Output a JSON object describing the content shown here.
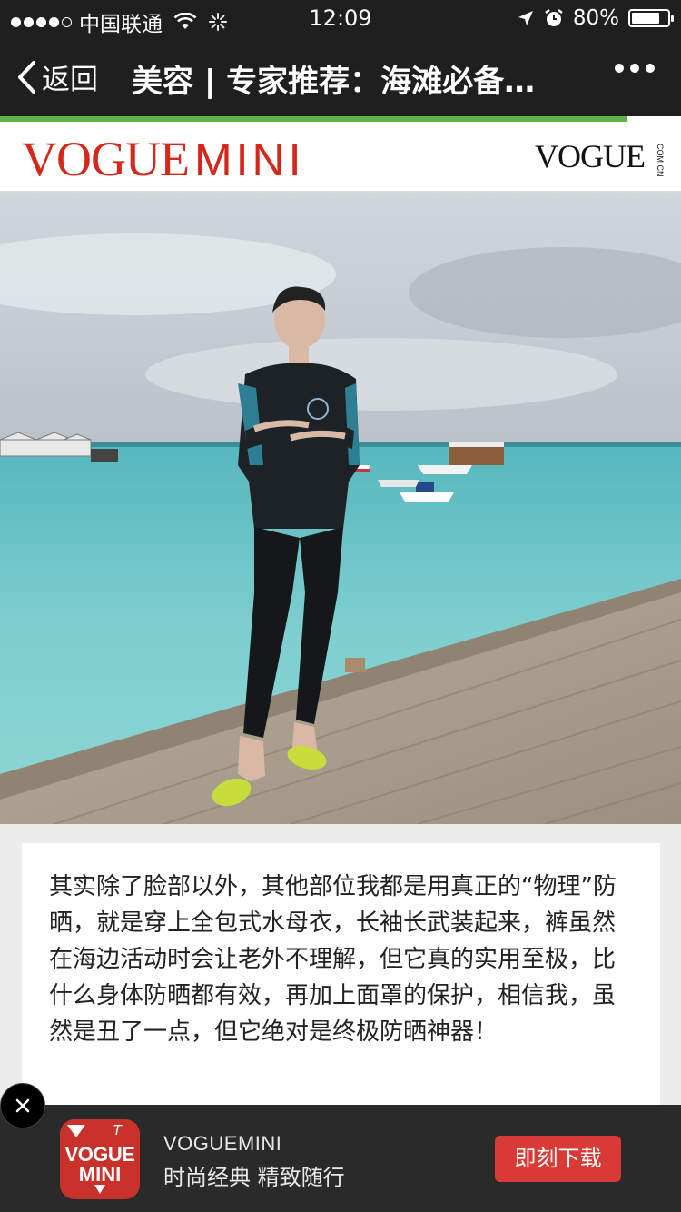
{
  "status_bar": {
    "carrier": "中国联通",
    "time": "12:09",
    "battery": "80%",
    "battery_level": 0.8
  },
  "nav": {
    "back_label": "返回",
    "title": "美容 | 专家推荐：海滩必备…"
  },
  "page_load_progress": 0.92,
  "brand": {
    "logo_main": "VOGUE",
    "logo_sub": "MINI",
    "logo_right": "VOGUE",
    "logo_right_sub": "COM.CN"
  },
  "article": {
    "paragraph": "其实除了脸部以外，其他部位我都是用真正的“物理”防晒，就是穿上全包式水母衣，长袖长武装起来，裤虽然在海边活动时会让老外不理解，但它真的实用至极，比什么身体防晒都有效，再加上面罩的保护，相信我，虽然是丑了一点，但它绝对是终极防晒神器！"
  },
  "ad_banner": {
    "app_icon_line1": "VOGUE",
    "app_icon_line2": "MINI",
    "app_icon_corner": "T",
    "app_name": "VOGUEMINI",
    "tagline": "时尚经典 精致随行",
    "button_label": "即刻下载"
  },
  "colors": {
    "bar_background": "#1f1f1f",
    "progress": "#5ab645",
    "brand_red": "#d5271b",
    "ad_button": "#d93a35"
  }
}
